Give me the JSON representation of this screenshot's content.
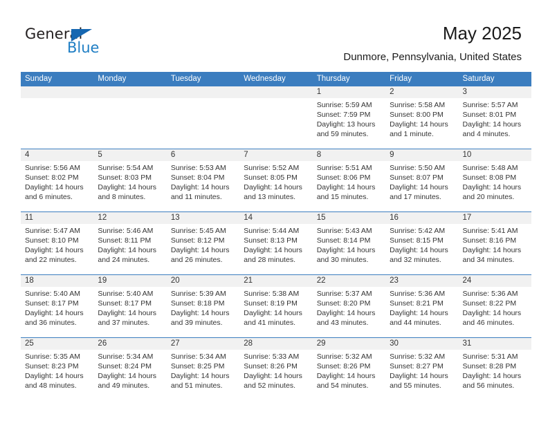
{
  "logo": {
    "word_top": "General",
    "word_bottom": "Blue",
    "triangle_color": "#1667b1",
    "blue_color": "#1f7ec4"
  },
  "header": {
    "title": "May 2025",
    "subtitle": "Dunmore, Pennsylvania, United States"
  },
  "theme": {
    "header_blue": "#3b7dbf",
    "date_band_gray": "#f1f1f1",
    "text": "#333333"
  },
  "weekdays": [
    "Sunday",
    "Monday",
    "Tuesday",
    "Wednesday",
    "Thursday",
    "Friday",
    "Saturday"
  ],
  "weeks": [
    [
      {
        "day": "",
        "empty": true
      },
      {
        "day": "",
        "empty": true
      },
      {
        "day": "",
        "empty": true
      },
      {
        "day": "",
        "empty": true
      },
      {
        "day": "1",
        "sunrise": "Sunrise: 5:59 AM",
        "sunset": "Sunset: 7:59 PM",
        "daylight": "Daylight: 13 hours and 59 minutes."
      },
      {
        "day": "2",
        "sunrise": "Sunrise: 5:58 AM",
        "sunset": "Sunset: 8:00 PM",
        "daylight": "Daylight: 14 hours and 1 minute."
      },
      {
        "day": "3",
        "sunrise": "Sunrise: 5:57 AM",
        "sunset": "Sunset: 8:01 PM",
        "daylight": "Daylight: 14 hours and 4 minutes."
      }
    ],
    [
      {
        "day": "4",
        "sunrise": "Sunrise: 5:56 AM",
        "sunset": "Sunset: 8:02 PM",
        "daylight": "Daylight: 14 hours and 6 minutes."
      },
      {
        "day": "5",
        "sunrise": "Sunrise: 5:54 AM",
        "sunset": "Sunset: 8:03 PM",
        "daylight": "Daylight: 14 hours and 8 minutes."
      },
      {
        "day": "6",
        "sunrise": "Sunrise: 5:53 AM",
        "sunset": "Sunset: 8:04 PM",
        "daylight": "Daylight: 14 hours and 11 minutes."
      },
      {
        "day": "7",
        "sunrise": "Sunrise: 5:52 AM",
        "sunset": "Sunset: 8:05 PM",
        "daylight": "Daylight: 14 hours and 13 minutes."
      },
      {
        "day": "8",
        "sunrise": "Sunrise: 5:51 AM",
        "sunset": "Sunset: 8:06 PM",
        "daylight": "Daylight: 14 hours and 15 minutes."
      },
      {
        "day": "9",
        "sunrise": "Sunrise: 5:50 AM",
        "sunset": "Sunset: 8:07 PM",
        "daylight": "Daylight: 14 hours and 17 minutes."
      },
      {
        "day": "10",
        "sunrise": "Sunrise: 5:48 AM",
        "sunset": "Sunset: 8:08 PM",
        "daylight": "Daylight: 14 hours and 20 minutes."
      }
    ],
    [
      {
        "day": "11",
        "sunrise": "Sunrise: 5:47 AM",
        "sunset": "Sunset: 8:10 PM",
        "daylight": "Daylight: 14 hours and 22 minutes."
      },
      {
        "day": "12",
        "sunrise": "Sunrise: 5:46 AM",
        "sunset": "Sunset: 8:11 PM",
        "daylight": "Daylight: 14 hours and 24 minutes."
      },
      {
        "day": "13",
        "sunrise": "Sunrise: 5:45 AM",
        "sunset": "Sunset: 8:12 PM",
        "daylight": "Daylight: 14 hours and 26 minutes."
      },
      {
        "day": "14",
        "sunrise": "Sunrise: 5:44 AM",
        "sunset": "Sunset: 8:13 PM",
        "daylight": "Daylight: 14 hours and 28 minutes."
      },
      {
        "day": "15",
        "sunrise": "Sunrise: 5:43 AM",
        "sunset": "Sunset: 8:14 PM",
        "daylight": "Daylight: 14 hours and 30 minutes."
      },
      {
        "day": "16",
        "sunrise": "Sunrise: 5:42 AM",
        "sunset": "Sunset: 8:15 PM",
        "daylight": "Daylight: 14 hours and 32 minutes."
      },
      {
        "day": "17",
        "sunrise": "Sunrise: 5:41 AM",
        "sunset": "Sunset: 8:16 PM",
        "daylight": "Daylight: 14 hours and 34 minutes."
      }
    ],
    [
      {
        "day": "18",
        "sunrise": "Sunrise: 5:40 AM",
        "sunset": "Sunset: 8:17 PM",
        "daylight": "Daylight: 14 hours and 36 minutes."
      },
      {
        "day": "19",
        "sunrise": "Sunrise: 5:40 AM",
        "sunset": "Sunset: 8:17 PM",
        "daylight": "Daylight: 14 hours and 37 minutes."
      },
      {
        "day": "20",
        "sunrise": "Sunrise: 5:39 AM",
        "sunset": "Sunset: 8:18 PM",
        "daylight": "Daylight: 14 hours and 39 minutes."
      },
      {
        "day": "21",
        "sunrise": "Sunrise: 5:38 AM",
        "sunset": "Sunset: 8:19 PM",
        "daylight": "Daylight: 14 hours and 41 minutes."
      },
      {
        "day": "22",
        "sunrise": "Sunrise: 5:37 AM",
        "sunset": "Sunset: 8:20 PM",
        "daylight": "Daylight: 14 hours and 43 minutes."
      },
      {
        "day": "23",
        "sunrise": "Sunrise: 5:36 AM",
        "sunset": "Sunset: 8:21 PM",
        "daylight": "Daylight: 14 hours and 44 minutes."
      },
      {
        "day": "24",
        "sunrise": "Sunrise: 5:36 AM",
        "sunset": "Sunset: 8:22 PM",
        "daylight": "Daylight: 14 hours and 46 minutes."
      }
    ],
    [
      {
        "day": "25",
        "sunrise": "Sunrise: 5:35 AM",
        "sunset": "Sunset: 8:23 PM",
        "daylight": "Daylight: 14 hours and 48 minutes."
      },
      {
        "day": "26",
        "sunrise": "Sunrise: 5:34 AM",
        "sunset": "Sunset: 8:24 PM",
        "daylight": "Daylight: 14 hours and 49 minutes."
      },
      {
        "day": "27",
        "sunrise": "Sunrise: 5:34 AM",
        "sunset": "Sunset: 8:25 PM",
        "daylight": "Daylight: 14 hours and 51 minutes."
      },
      {
        "day": "28",
        "sunrise": "Sunrise: 5:33 AM",
        "sunset": "Sunset: 8:26 PM",
        "daylight": "Daylight: 14 hours and 52 minutes."
      },
      {
        "day": "29",
        "sunrise": "Sunrise: 5:32 AM",
        "sunset": "Sunset: 8:26 PM",
        "daylight": "Daylight: 14 hours and 54 minutes."
      },
      {
        "day": "30",
        "sunrise": "Sunrise: 5:32 AM",
        "sunset": "Sunset: 8:27 PM",
        "daylight": "Daylight: 14 hours and 55 minutes."
      },
      {
        "day": "31",
        "sunrise": "Sunrise: 5:31 AM",
        "sunset": "Sunset: 8:28 PM",
        "daylight": "Daylight: 14 hours and 56 minutes."
      }
    ]
  ]
}
